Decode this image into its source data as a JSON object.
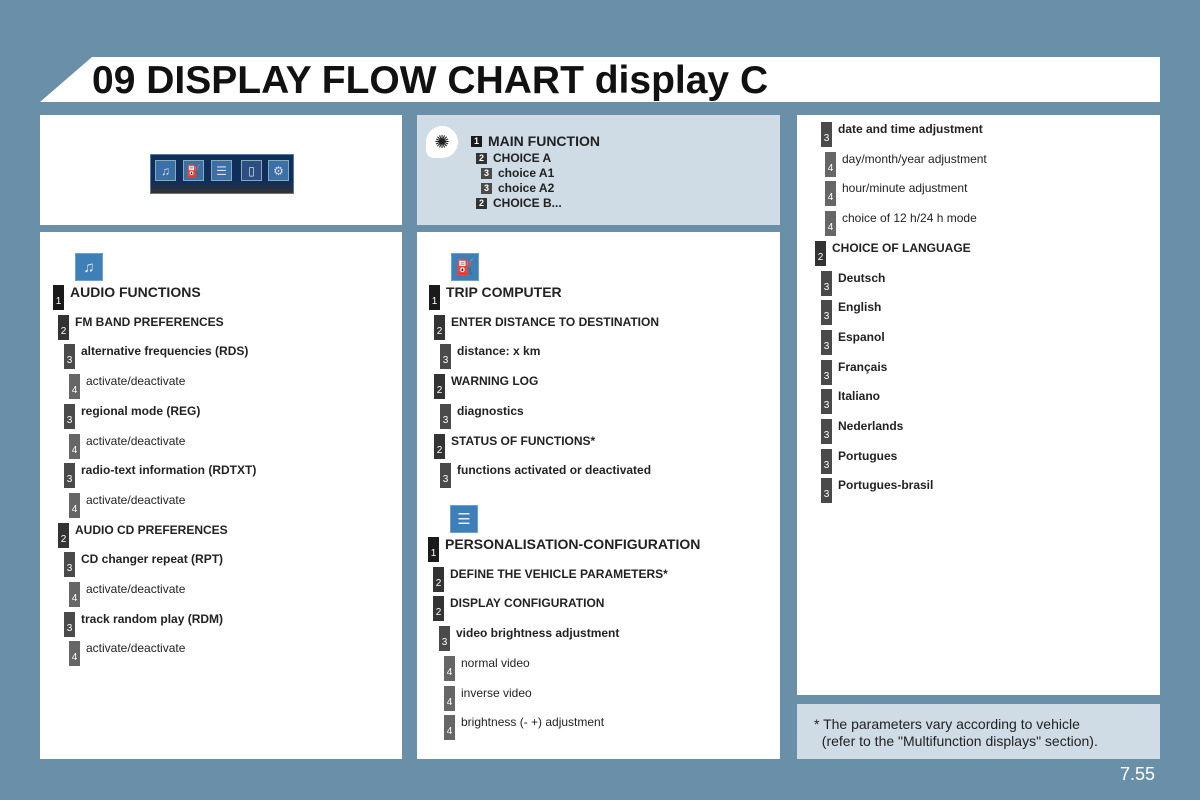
{
  "title": "09 DISPLAY FLOW CHART display C",
  "icon_strip": [
    "audio-icon",
    "trip-computer-icon",
    "personalisation-icon",
    "telephone-icon",
    "settings-icon"
  ],
  "legend": {
    "icon": "lightbulb-icon",
    "items": [
      {
        "level": "1",
        "text": "MAIN FUNCTION"
      },
      {
        "level": "2",
        "text": "CHOICE A"
      },
      {
        "level": "3",
        "text": "choice A1"
      },
      {
        "level": "3",
        "text": "choice A2"
      },
      {
        "level": "2",
        "text": "CHOICE B..."
      }
    ]
  },
  "audio": {
    "icon": "audio-icon",
    "items": [
      {
        "level": "1",
        "text": "AUDIO FUNCTIONS"
      },
      {
        "level": "2",
        "text": "FM BAND PREFERENCES"
      },
      {
        "level": "3",
        "text": "alternative frequencies (RDS)"
      },
      {
        "level": "4",
        "text": "activate/deactivate"
      },
      {
        "level": "3",
        "text": "regional mode (REG)"
      },
      {
        "level": "4",
        "text": "activate/deactivate"
      },
      {
        "level": "3",
        "text": "radio-text information (RDTXT)"
      },
      {
        "level": "4",
        "text": "activate/deactivate"
      },
      {
        "level": "2",
        "text": "AUDIO CD PREFERENCES"
      },
      {
        "level": "3",
        "text": "CD changer repeat (RPT)"
      },
      {
        "level": "4",
        "text": "activate/deactivate"
      },
      {
        "level": "3",
        "text": "track random play (RDM)"
      },
      {
        "level": "4",
        "text": "activate/deactivate"
      }
    ]
  },
  "trip": {
    "icon": "fuel-pump-icon",
    "items": [
      {
        "level": "1",
        "text": "TRIP COMPUTER"
      },
      {
        "level": "2",
        "text": "ENTER DISTANCE TO DESTINATION"
      },
      {
        "level": "3",
        "text": "distance: x km"
      },
      {
        "level": "2",
        "text": "WARNING LOG"
      },
      {
        "level": "3",
        "text": "diagnostics"
      },
      {
        "level": "2",
        "text": "STATUS OF FUNCTIONS*"
      },
      {
        "level": "3",
        "text": "functions activated or deactivated"
      }
    ]
  },
  "personal": {
    "icon": "sliders-icon",
    "items": [
      {
        "level": "1",
        "text": "PERSONALISATION-CONFIGURATION"
      },
      {
        "level": "2",
        "text": "DEFINE THE VEHICLE PARAMETERS*"
      },
      {
        "level": "2",
        "text": "DISPLAY CONFIGURATION"
      },
      {
        "level": "3",
        "text": "video brightness adjustment"
      },
      {
        "level": "4",
        "text": "normal video"
      },
      {
        "level": "4",
        "text": "inverse video"
      },
      {
        "level": "4",
        "text": "brightness (- +) adjustment"
      }
    ]
  },
  "right": {
    "items": [
      {
        "level": "3",
        "text": "date and time adjustment"
      },
      {
        "level": "4",
        "text": "day/month/year adjustment"
      },
      {
        "level": "4",
        "text": "hour/minute adjustment"
      },
      {
        "level": "4",
        "text": "choice of 12 h/24 h mode"
      },
      {
        "level": "2",
        "text": "CHOICE OF LANGUAGE"
      },
      {
        "level": "3",
        "text": "Deutsch"
      },
      {
        "level": "3",
        "text": "English"
      },
      {
        "level": "3",
        "text": "Espanol"
      },
      {
        "level": "3",
        "text": "Français"
      },
      {
        "level": "3",
        "text": "Italiano"
      },
      {
        "level": "3",
        "text": "Nederlands"
      },
      {
        "level": "3",
        "text": "Portugues"
      },
      {
        "level": "3",
        "text": "Portugues-brasil"
      }
    ]
  },
  "note": "* The parameters vary according to vehicle\n  (refer to the \"Multifunction displays\" section).",
  "page_number": "7.55",
  "colors": {
    "background": "#6a8fa8",
    "legend_panel": "#cfdbe5",
    "icon_blue": "#3f7fb8"
  }
}
